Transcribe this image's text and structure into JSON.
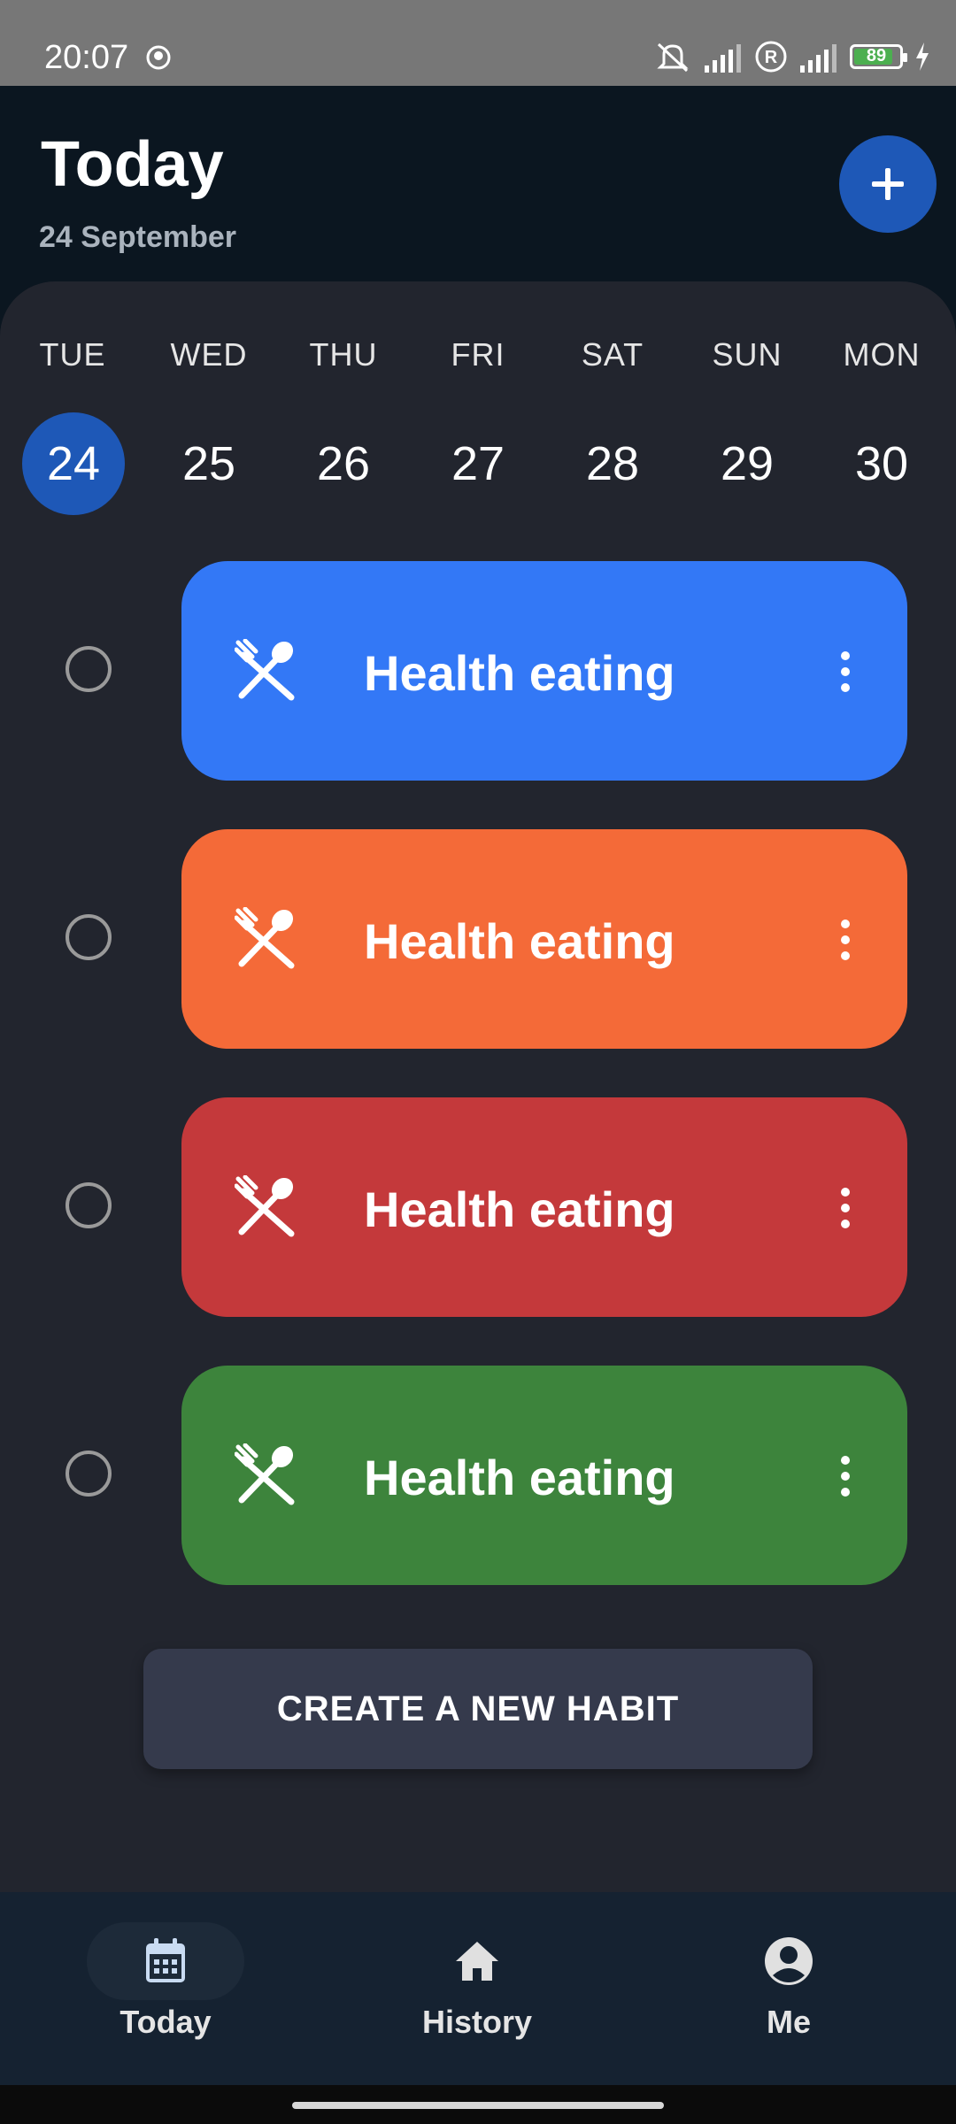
{
  "status_bar": {
    "time": "20:07",
    "battery": "89",
    "icons": [
      "app-icon",
      "mute-icon",
      "signal-icon",
      "roaming-icon",
      "signal-icon",
      "battery-icon",
      "charging-icon"
    ]
  },
  "header": {
    "title": "Today",
    "date": "24 September",
    "fab_icon": "plus-icon"
  },
  "calendar": {
    "weekdays": [
      "TUE",
      "WED",
      "THU",
      "FRI",
      "SAT",
      "SUN",
      "MON"
    ],
    "days": [
      "24",
      "25",
      "26",
      "27",
      "28",
      "29",
      "30"
    ],
    "selected": "24"
  },
  "habits": [
    {
      "label": "Health eating",
      "color": "#3378f6",
      "icon": "fork-spoon-icon"
    },
    {
      "label": "Health eating",
      "color": "#f46a38",
      "icon": "fork-spoon-icon"
    },
    {
      "label": "Health eating",
      "color": "#c4393b",
      "icon": "fork-spoon-icon"
    },
    {
      "label": "Health eating",
      "color": "#3d843c",
      "icon": "fork-spoon-icon"
    }
  ],
  "create_button": "CREATE A NEW HABIT",
  "bottom_nav": {
    "items": [
      {
        "label": "Today",
        "icon": "calendar-icon"
      },
      {
        "label": "History",
        "icon": "home-icon"
      },
      {
        "label": "Me",
        "icon": "account-icon"
      }
    ]
  }
}
